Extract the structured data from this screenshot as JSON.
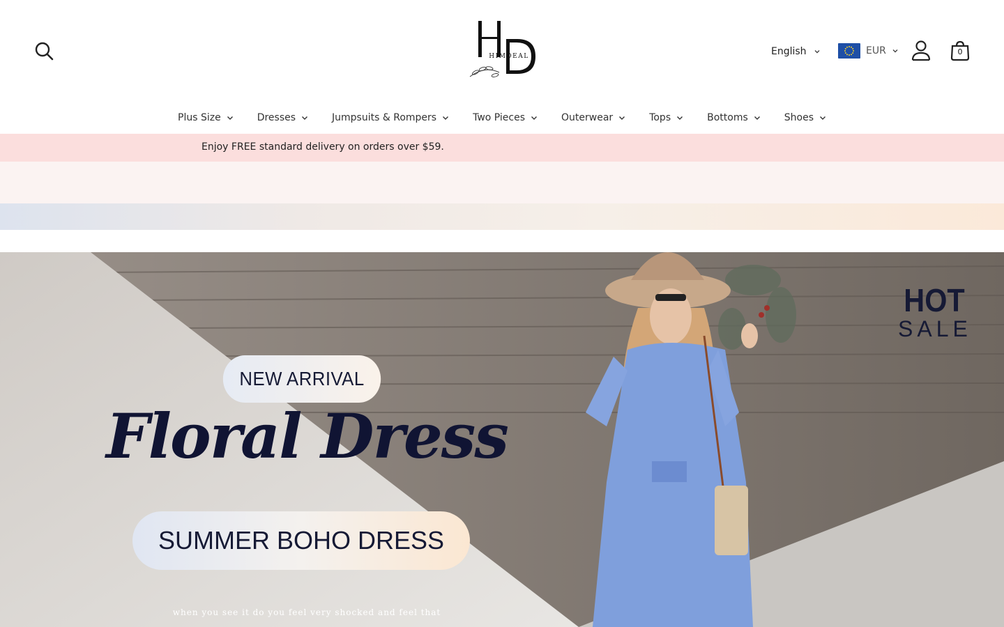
{
  "brand": {
    "name": "HIMDEAL",
    "monogram": "HD"
  },
  "header": {
    "language": "English",
    "currency": "EUR",
    "cart_count": "0"
  },
  "nav": {
    "items": [
      {
        "label": "Plus Size"
      },
      {
        "label": "Dresses"
      },
      {
        "label": "Jumpsuits & Rompers"
      },
      {
        "label": "Two Pieces"
      },
      {
        "label": "Outerwear"
      },
      {
        "label": "Tops"
      },
      {
        "label": "Bottoms"
      },
      {
        "label": "Shoes"
      }
    ]
  },
  "announcement": {
    "text": "Enjoy FREE standard delivery on orders over $59."
  },
  "hero": {
    "badge_top": "NEW ARRIVAL",
    "script_title": "Floral Dress",
    "badge_bottom": "SUMMER BOHO DRESS",
    "tagline": "when you see it do you feel very shocked and feel that",
    "corner_hot": "HOT",
    "corner_sale": "SALE"
  },
  "colors": {
    "promo_bar": "#fbdedd",
    "hero_text": "#161a35",
    "flag": "#1e4fa6"
  },
  "icons": [
    "search-icon",
    "chevron-down-icon",
    "eu-flag-icon",
    "user-icon",
    "bag-icon"
  ]
}
